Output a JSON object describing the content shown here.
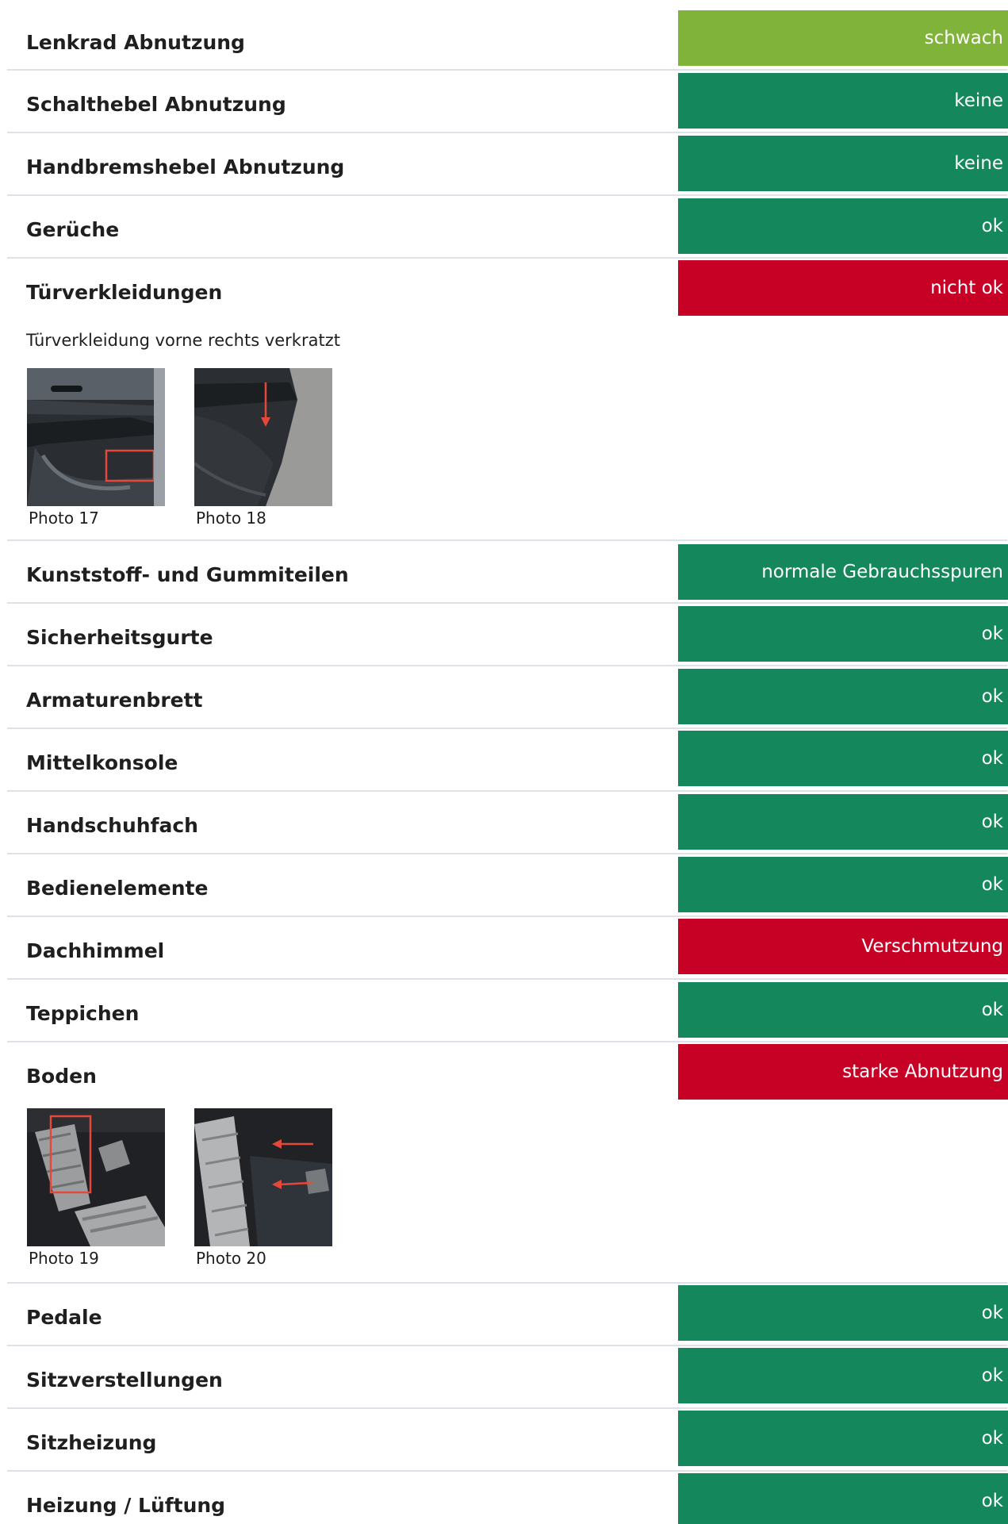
{
  "colors": {
    "ok": "#15875c",
    "weak": "#80b33a",
    "bad": "#c70026",
    "divider": "#dde1e8"
  },
  "rows": [
    {
      "label": "Lenkrad Abnutzung",
      "status": "schwach",
      "color": "#80b33a"
    },
    {
      "label": "Schalthebel Abnutzung",
      "status": "keine",
      "color": "#15875c"
    },
    {
      "label": "Handbremshebel Abnutzung",
      "status": "keine",
      "color": "#15875c"
    },
    {
      "label": "Gerüche",
      "status": "ok",
      "color": "#15875c"
    },
    {
      "label": "Türverkleidungen",
      "status": "nicht ok",
      "color": "#c70026",
      "note": "Türverkleidung vorne rechts verkratzt",
      "photos": [
        {
          "caption": "Photo 17"
        },
        {
          "caption": "Photo 18"
        }
      ]
    },
    {
      "label": "Kunststoff- und Gummiteilen",
      "status": "normale Gebrauchsspuren",
      "color": "#15875c"
    },
    {
      "label": "Sicherheitsgurte",
      "status": "ok",
      "color": "#15875c"
    },
    {
      "label": "Armaturenbrett",
      "status": "ok",
      "color": "#15875c"
    },
    {
      "label": "Mittelkonsole",
      "status": "ok",
      "color": "#15875c"
    },
    {
      "label": "Handschuhfach",
      "status": "ok",
      "color": "#15875c"
    },
    {
      "label": "Bedienelemente",
      "status": "ok",
      "color": "#15875c"
    },
    {
      "label": "Dachhimmel",
      "status": "Verschmutzung",
      "color": "#c70026"
    },
    {
      "label": "Teppichen",
      "status": "ok",
      "color": "#15875c"
    },
    {
      "label": "Boden",
      "status": "starke Abnutzung",
      "color": "#c70026",
      "photos": [
        {
          "caption": "Photo 19"
        },
        {
          "caption": "Photo 20"
        }
      ]
    },
    {
      "label": "Pedale",
      "status": "ok",
      "color": "#15875c"
    },
    {
      "label": "Sitzverstellungen",
      "status": "ok",
      "color": "#15875c"
    },
    {
      "label": "Sitzheizung",
      "status": "ok",
      "color": "#15875c"
    },
    {
      "label": "Heizung / Lüftung",
      "status": "ok",
      "color": "#15875c"
    }
  ]
}
